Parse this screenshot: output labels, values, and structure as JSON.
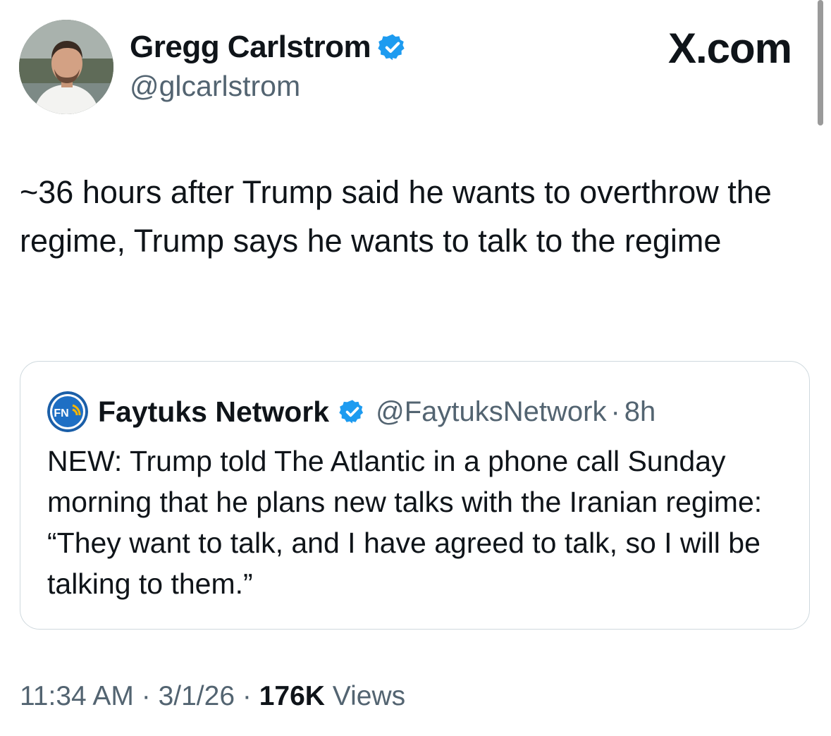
{
  "tweet": {
    "author_name": "Gregg Carlstrom",
    "author_handle": "@glcarlstrom",
    "text": "~36 hours after Trump said he wants to overthrow the regime, Trump says he wants to talk to the regime",
    "time": "11:34 AM",
    "date": "3/1/26",
    "views_count": "176K",
    "views_label": "Views",
    "separator": "·"
  },
  "brand": "X.com",
  "quoted": {
    "author_name": "Faytuks Network",
    "author_handle": "@FaytuksNetwork",
    "age": "8h",
    "separator": "·",
    "text": "NEW: Trump told The Atlantic in a phone call Sunday morning that he plans new talks with the Iranian regime: “They want to talk, and I have agreed to talk, so I will be talking to them.”",
    "logo_text": "FN"
  },
  "colors": {
    "verified_blue": "#1d9bf0",
    "secondary_text": "#536471",
    "primary_text": "#0f1419",
    "card_border": "#cfd9de"
  },
  "icons": {
    "verified": "verified-badge-icon",
    "avatar": "profile-photo",
    "quoted_logo": "faytuks-logo-icon"
  }
}
